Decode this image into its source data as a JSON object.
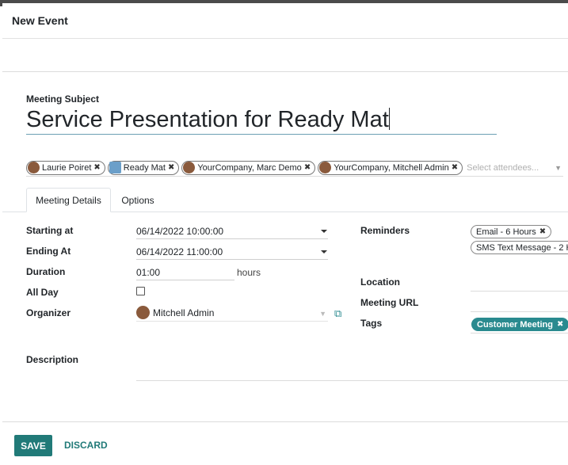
{
  "modal": {
    "title": "New Event"
  },
  "subject": {
    "label": "Meeting Subject",
    "value": "Service Presentation for Ready Mat"
  },
  "attendees": {
    "tags": [
      {
        "name": "Laurie Poiret"
      },
      {
        "name": "Ready Mat"
      },
      {
        "name": "YourCompany, Marc Demo"
      },
      {
        "name": "YourCompany, Mitchell Admin"
      }
    ],
    "placeholder": "Select attendees..."
  },
  "tabs": [
    {
      "label": "Meeting Details"
    },
    {
      "label": "Options"
    }
  ],
  "fields": {
    "starting_at": {
      "label": "Starting at",
      "value": "06/14/2022 10:00:00"
    },
    "ending_at": {
      "label": "Ending At",
      "value": "06/14/2022 11:00:00"
    },
    "duration": {
      "label": "Duration",
      "value": "01:00",
      "unit": "hours"
    },
    "all_day": {
      "label": "All Day"
    },
    "organizer": {
      "label": "Organizer",
      "value": "Mitchell Admin"
    },
    "description": {
      "label": "Description"
    },
    "reminders": {
      "label": "Reminders",
      "tags": [
        "Email - 6 Hours",
        "SMS Text Message - 2 H"
      ]
    },
    "location": {
      "label": "Location"
    },
    "meeting_url": {
      "label": "Meeting URL"
    },
    "tags": {
      "label": "Tags",
      "items": [
        "Customer Meeting"
      ]
    }
  },
  "footer": {
    "save_label": "SAVE",
    "discard_label": "DISCARD"
  },
  "colors": {
    "primary": "#217a78",
    "tag_accent": "#2a8a8f"
  }
}
